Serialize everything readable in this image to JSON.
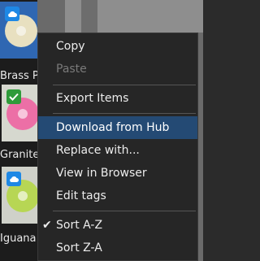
{
  "thumbnails": [
    {
      "name": "Brass Plate",
      "label": "Brass P",
      "selected": true,
      "badge": "cloud-icon",
      "color": "#e9e2c6"
    },
    {
      "name": "Granite Plate",
      "label": "Granite",
      "selected": false,
      "badge": "check-icon",
      "color": "#ec6fa6"
    },
    {
      "name": "Iguana Plate",
      "label": "Iguana",
      "selected": false,
      "badge": "cloud-icon",
      "color": "#b7d654"
    }
  ],
  "menu": {
    "copy": "Copy",
    "paste": "Paste",
    "export_items": "Export Items",
    "download_from_hub": "Download from Hub",
    "replace_with": "Replace with...",
    "view_in_browser": "View in Browser",
    "edit_tags": "Edit tags",
    "sort_az": "Sort A-Z",
    "sort_za": "Sort Z-A"
  },
  "colors": {
    "highlight": "#244a74",
    "menu_bg": "#262626",
    "selected_thumb": "#2f67b2"
  }
}
